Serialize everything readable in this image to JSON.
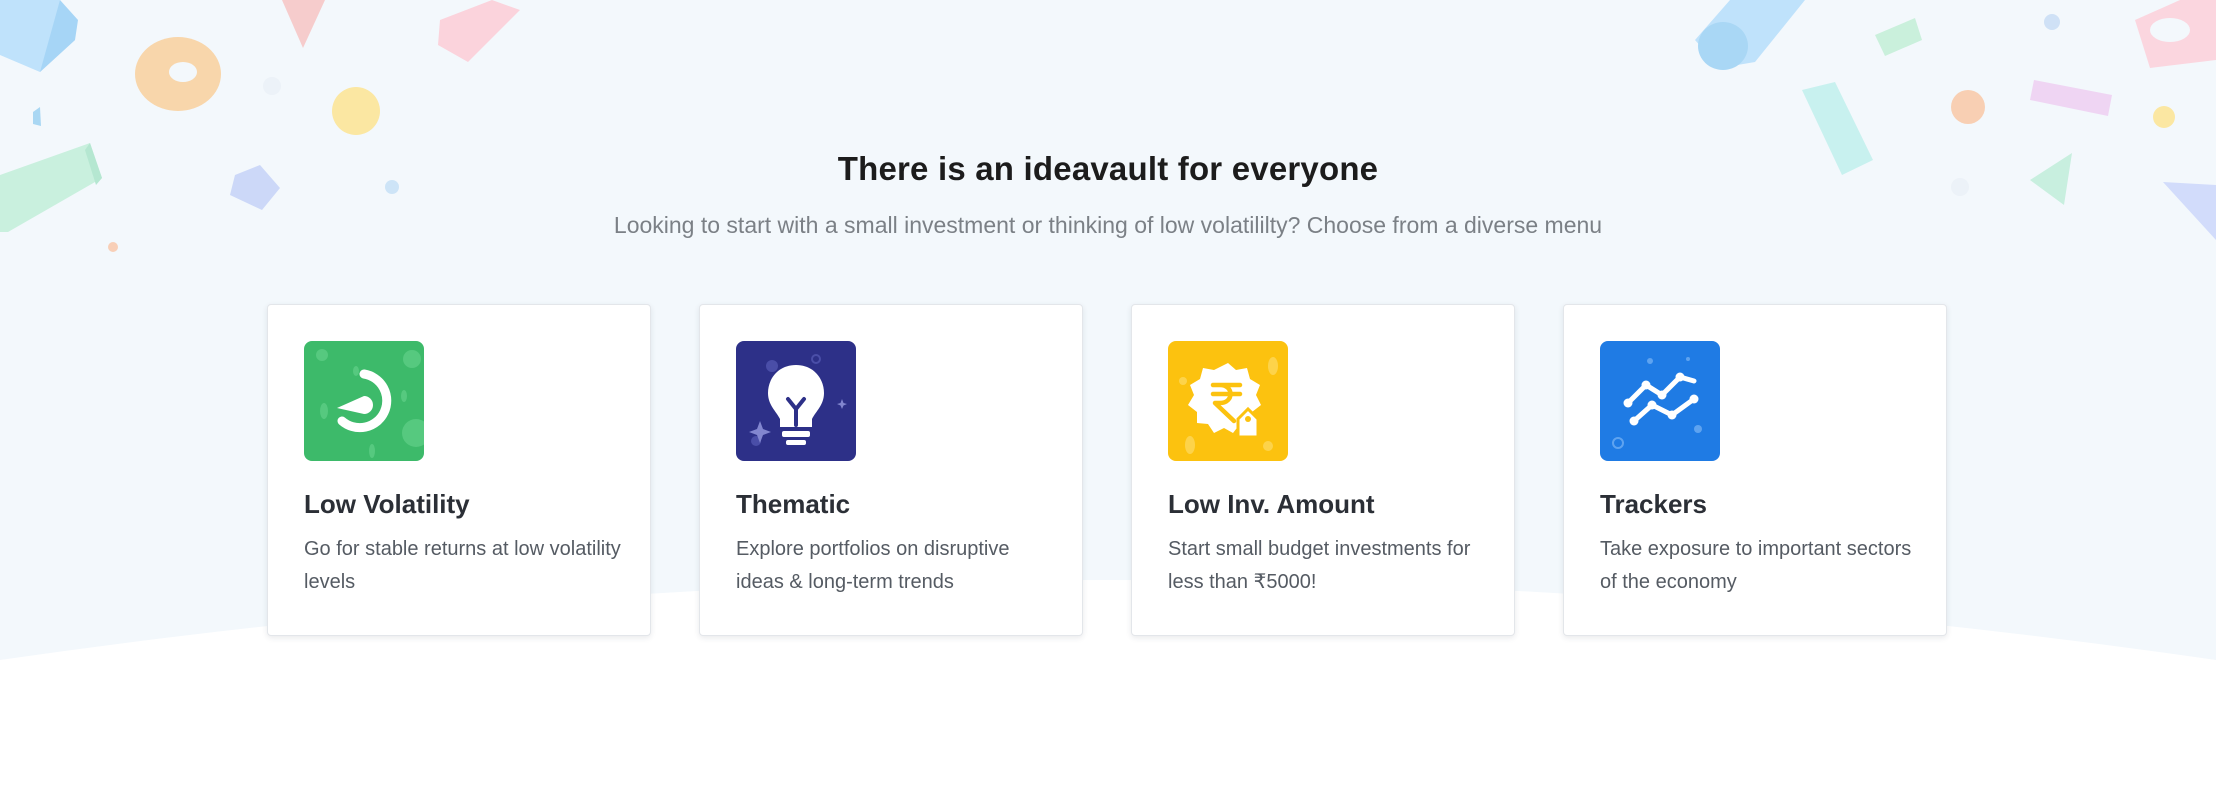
{
  "section": {
    "heading": "There is an ideavault for everyone",
    "subheading": "Looking to start with a small investment or thinking of low volatililty? Choose from a diverse menu"
  },
  "cards": [
    {
      "title": "Low Volatility",
      "desc": "Go for stable returns at low volatility levels",
      "icon": "speedometer-icon",
      "color": "#3dba6a"
    },
    {
      "title": "Thematic",
      "desc": "Explore portfolios on disruptive ideas & long-term trends",
      "icon": "lightbulb-icon",
      "color": "#2d3088"
    },
    {
      "title": "Low Inv. Amount",
      "desc": "Start small budget investments for less than ₹5000!",
      "icon": "rupee-badge-icon",
      "color": "#fcc20f"
    },
    {
      "title": "Trackers",
      "desc": "Take exposure to important sectors of the economy",
      "icon": "trend-lines-icon",
      "color": "#1f7be4"
    }
  ],
  "colors": {
    "background_tint": "#f3f8fc",
    "heading": "#1c1c1c",
    "subheading": "#7b8086"
  }
}
